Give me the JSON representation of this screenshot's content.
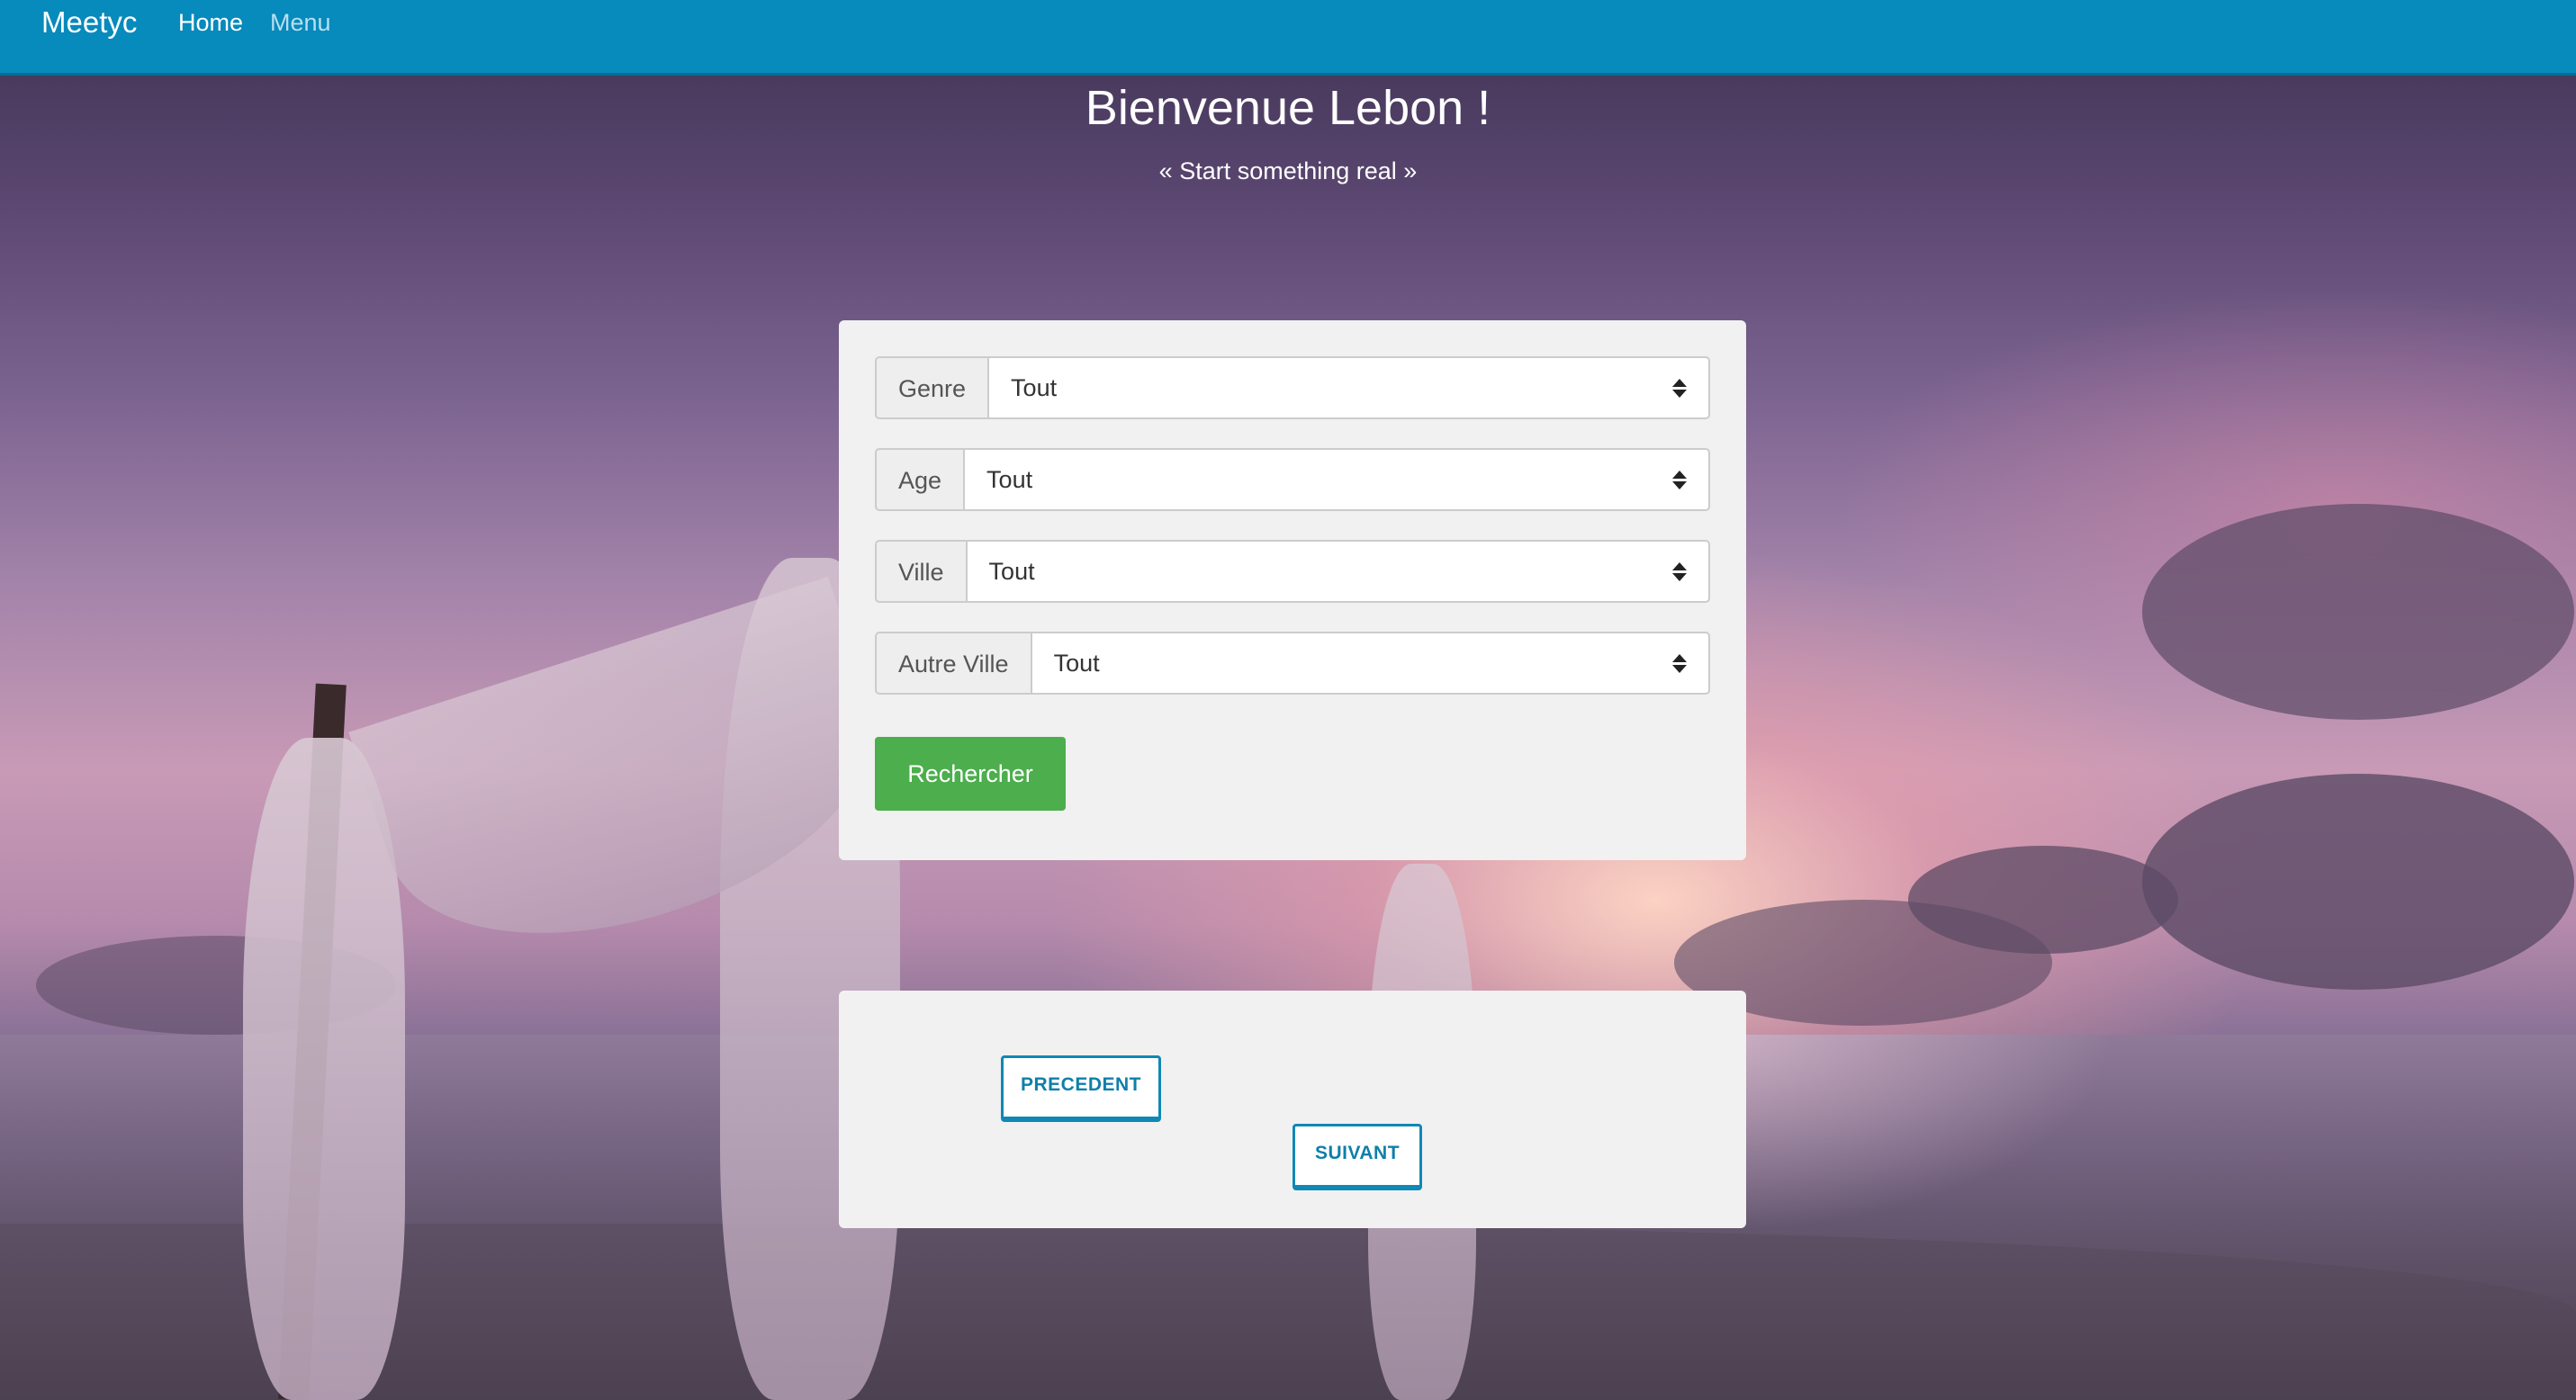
{
  "navbar": {
    "brand": "Meetyc",
    "links": [
      {
        "label": "Home",
        "active": true
      },
      {
        "label": "Menu",
        "active": false
      }
    ],
    "color": "#078abc"
  },
  "hero": {
    "title": "Bienvenue Lebon !",
    "subtitle": "« Start something real »"
  },
  "search": {
    "filters": [
      {
        "label": "Genre",
        "value": "Tout"
      },
      {
        "label": "Age",
        "value": "Tout"
      },
      {
        "label": "Ville",
        "value": "Tout"
      },
      {
        "label": "Autre Ville",
        "value": "Tout"
      }
    ],
    "submit_label": "Rechercher",
    "submit_color": "#4cae4c"
  },
  "pager": {
    "prev_label": "PRECEDENT",
    "next_label": "SUIVANT"
  },
  "icons": {
    "select_arrow": "updown-caret-icon"
  }
}
